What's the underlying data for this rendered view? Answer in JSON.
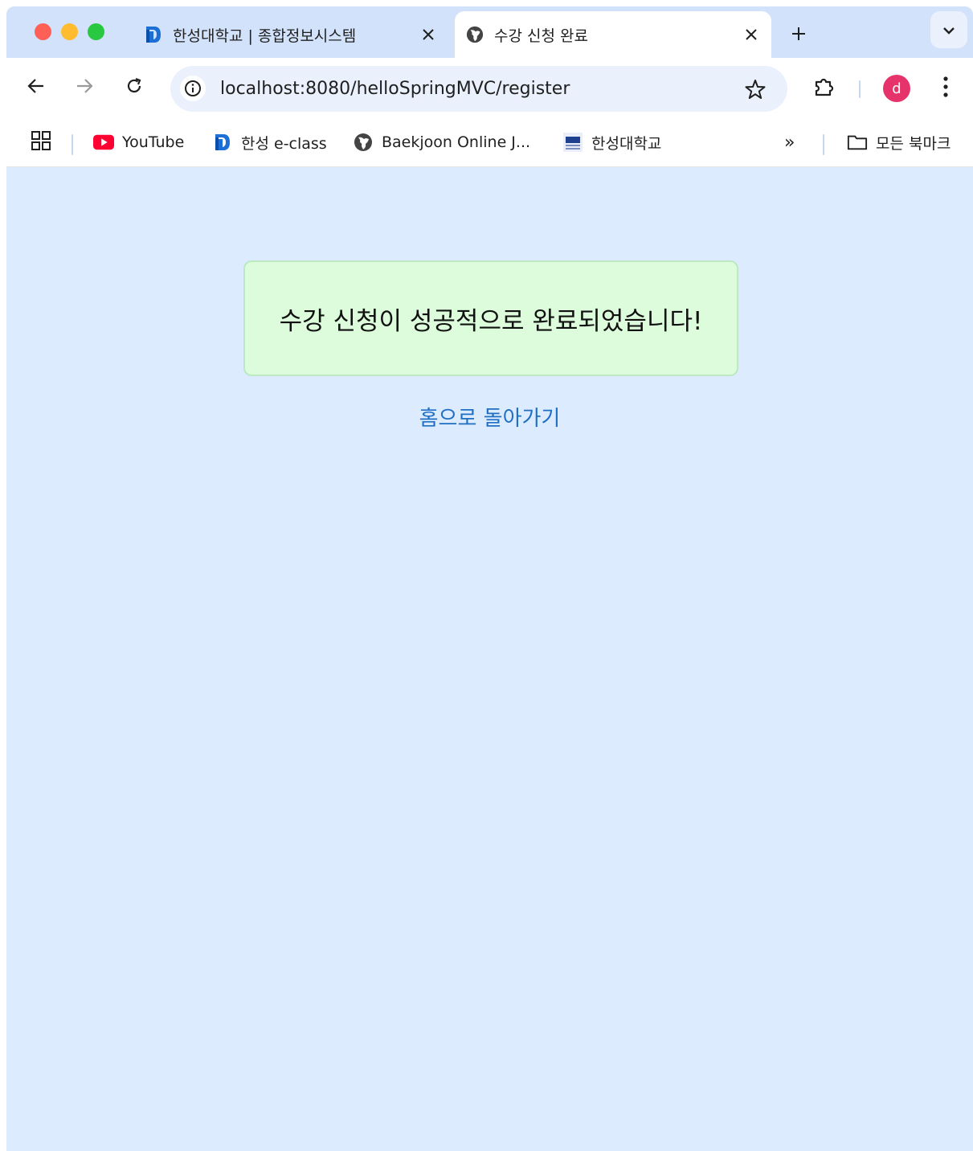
{
  "tabs": [
    {
      "title": "한성대학교 | 종합정보시스템",
      "favicon": "hansung-logo-icon",
      "active": false
    },
    {
      "title": "수강 신청 완료",
      "favicon": "globe-icon",
      "active": true
    }
  ],
  "toolbar": {
    "url": "localhost:8080/helloSpringMVC/register",
    "avatar_letter": "d"
  },
  "bookmarks": {
    "items": [
      {
        "label": "YouTube",
        "icon": "youtube-icon"
      },
      {
        "label": "한성 e-class",
        "icon": "hansung-logo-icon"
      },
      {
        "label": "Baekjoon Online J...",
        "icon": "globe-icon"
      },
      {
        "label": "한성대학교",
        "icon": "hsu-logo-icon"
      }
    ],
    "overflow": "»",
    "all_bookmarks_label": "모든 북마크"
  },
  "page": {
    "success_message": "수강 신청이 성공적으로 완료되었습니다!",
    "home_link": "홈으로 돌아가기"
  },
  "colors": {
    "tabstrip": "#d3e2fb",
    "page_background": "#dcebfd",
    "success_box": "#dcfcdc",
    "success_border": "#bce8c4",
    "link": "#1f6fc5",
    "avatar": "#e6336b"
  }
}
